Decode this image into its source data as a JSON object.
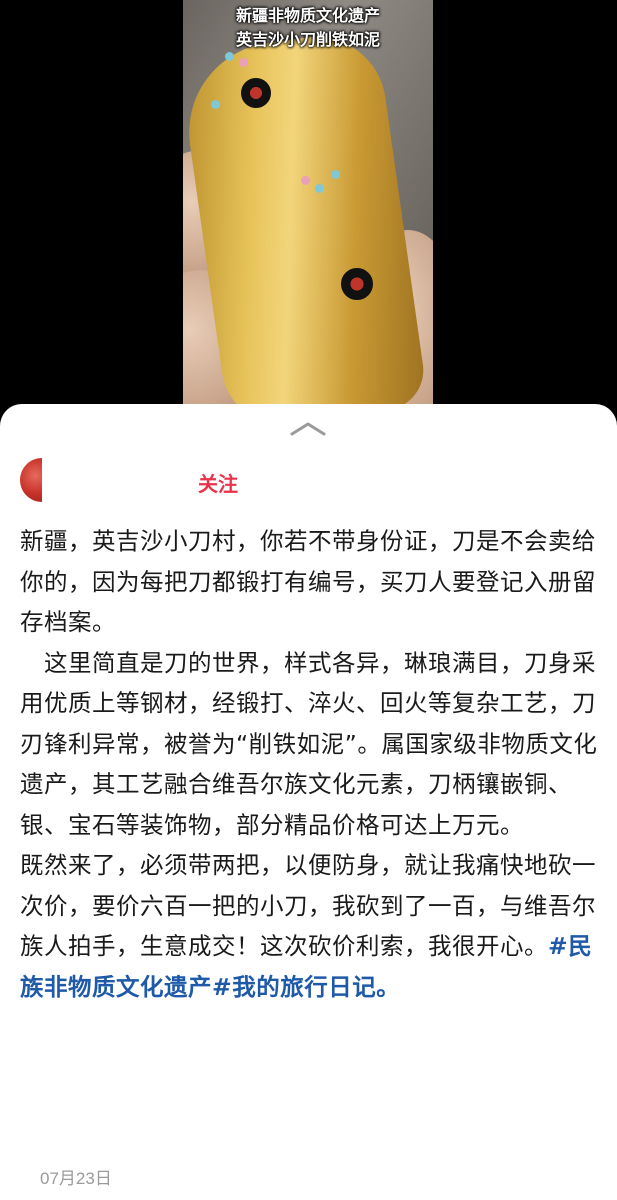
{
  "video": {
    "caption_line1": "新疆非物质文化遗产",
    "caption_line2": "英吉沙小刀削铁如泥"
  },
  "author": {
    "follow_label": "关注"
  },
  "post": {
    "paragraph1": "新疆，英吉沙小刀村，你若不带身份证，刀是不会卖给你的，因为每把刀都锻打有编号，买刀人要登记入册留存档案。",
    "paragraph2": "　这里简直是刀的世界，样式各异，琳琅满目，刀身采用优质上等钢材，经锻打、淬火、回火等复杂工艺，刀刃锋利异常，被誉为“削铁如泥”。属国家级非物质文化遗产，其工艺融合维吾尔族文化元素，刀柄镶嵌铜、银、宝石等装饰物，部分精品价格可达上万元。",
    "paragraph3_text": " 既然来了，必须带两把，以便防身，就让我痛快地砍一次价，要价六百一把的小刀，我砍到了一百，与维吾尔族人拍手，生意成交！这次砍价利索，我很开心。",
    "hashtag1": "#民族非物质文化遗产#",
    "hashtag2": "我的旅行日记。",
    "date": "07月23日"
  },
  "colors": {
    "follow": "#e8334a",
    "hashtag": "#1f5aa8",
    "date": "#9a9a9a"
  },
  "icons": [
    "chevron-up-icon",
    "avatar"
  ]
}
